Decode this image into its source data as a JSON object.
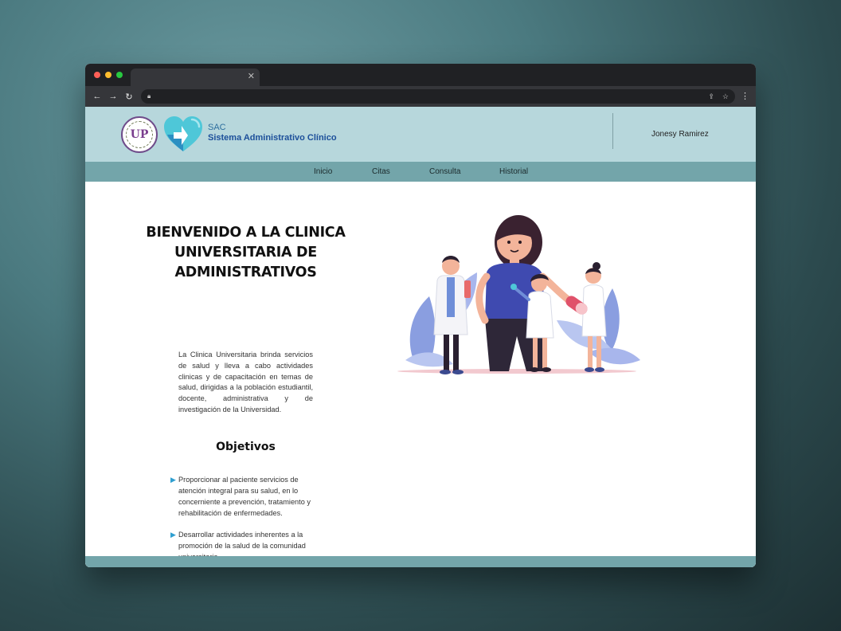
{
  "header": {
    "brand_short": "SAC",
    "brand_full": "Sistema Administrativo Clínico",
    "seal_text": "UP",
    "user_name": "Jonesy Ramirez"
  },
  "nav": {
    "items": [
      {
        "label": "Inicio"
      },
      {
        "label": "Citas"
      },
      {
        "label": "Consulta"
      },
      {
        "label": "Historial"
      }
    ]
  },
  "main": {
    "welcome_lines": [
      "BIENVENIDO A LA CLINICA",
      "UNIVERSITARIA DE",
      "ADMINISTRATIVOS"
    ],
    "intro": "La Clinica Universitaria brinda servicios de salud y lleva a cabo actividades clinicas y de capacitación en temas de salud, dirigidas a la población estudiantil, docente, administrativa y de investigación de la Universidad.",
    "objectives_title": "Objetivos",
    "objectives": [
      "Proporcionar al paciente servicios de atención integral para su salud, en lo concerniente a prevención, tratamiento y rehabilitación de enfermedades.",
      "Desarrollar actividades inherentes a la promoción de la salud de la comunidad universitaria."
    ]
  },
  "colors": {
    "header_bg": "#b7d7dc",
    "nav_bg": "#73a5aa",
    "brand_blue": "#1c4f9a",
    "bullet_blue": "#2f9fd0"
  },
  "icons": {
    "seal": "university-seal-logo",
    "heart": "heart-logo",
    "bullet": "triangle-bullet-icon"
  }
}
